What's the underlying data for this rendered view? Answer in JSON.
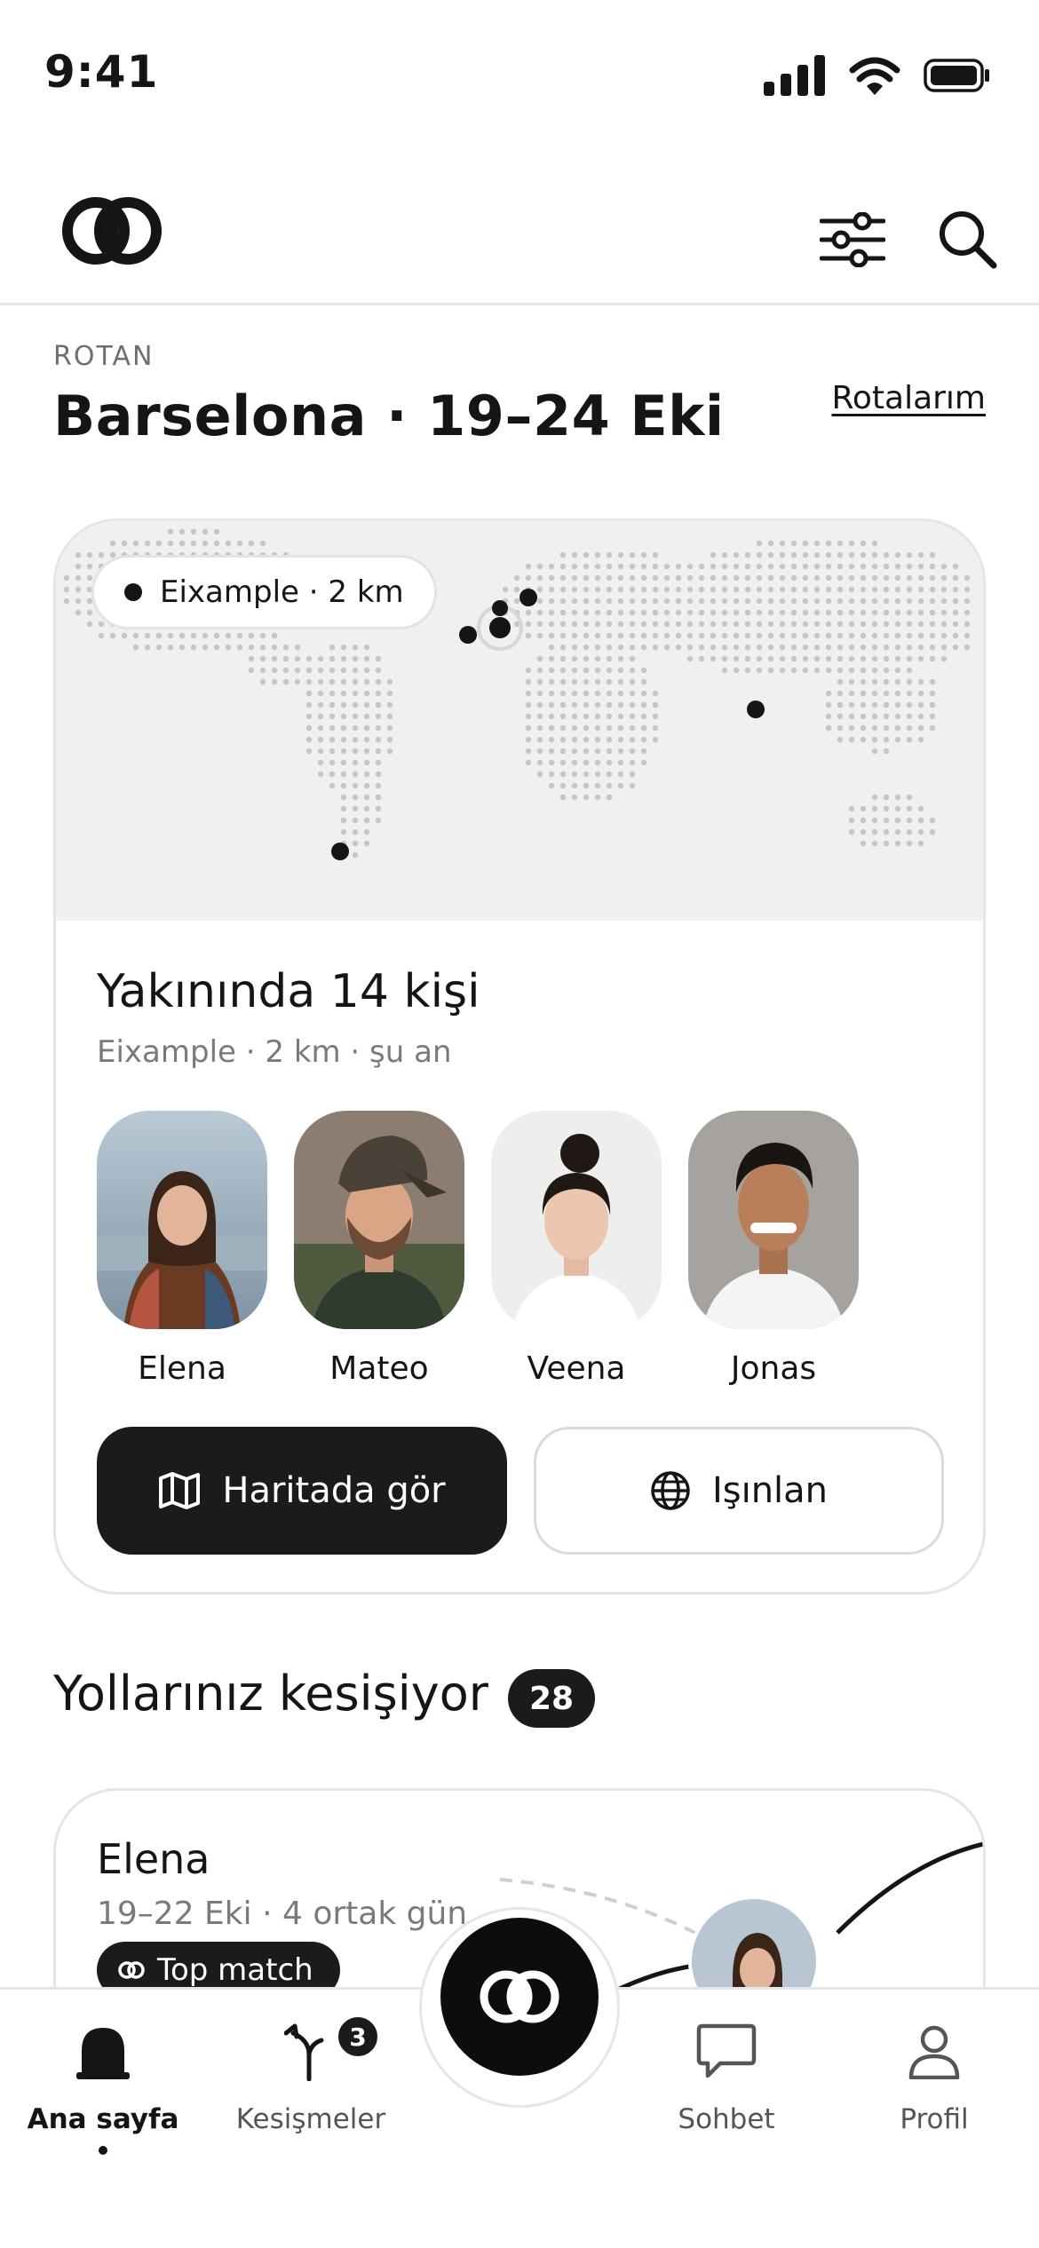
{
  "status_bar": {
    "time": "9:41"
  },
  "route": {
    "label": "ROTAN",
    "title": "Barselona · 19–24 Eki",
    "link": "Rotalarım"
  },
  "map": {
    "chip": "Eixample · 2 km"
  },
  "nearby": {
    "title": "Yakınında 14 kişi",
    "subtitle": "Eixample · 2 km · şu an",
    "people": [
      {
        "name": "Elena"
      },
      {
        "name": "Mateo"
      },
      {
        "name": "Veena"
      },
      {
        "name": "Jonas"
      }
    ],
    "primary_button": "Haritada gör",
    "secondary_button": "Işınlan"
  },
  "intersect": {
    "title": "Yollarınız kesişiyor",
    "count": "28",
    "card": {
      "name": "Elena",
      "subtitle": "19–22 Eki · 4 ortak gün",
      "badge": "Top match"
    }
  },
  "tabbar": {
    "tabs": [
      {
        "label": "Ana sayfa",
        "icon": "home-arch-icon"
      },
      {
        "label": "Kesişmeler",
        "icon": "intersect-icon",
        "badge": "3"
      },
      {
        "label": "Sohbet",
        "icon": "chat-bubble-icon"
      },
      {
        "label": "Profil",
        "icon": "person-icon"
      }
    ],
    "center_icon": "logo-rings-icon"
  },
  "colors": {
    "ink": "#151515",
    "muted": "#7a7a7a",
    "map_bg": "#f0f0ee",
    "border": "#e5e5e5"
  }
}
